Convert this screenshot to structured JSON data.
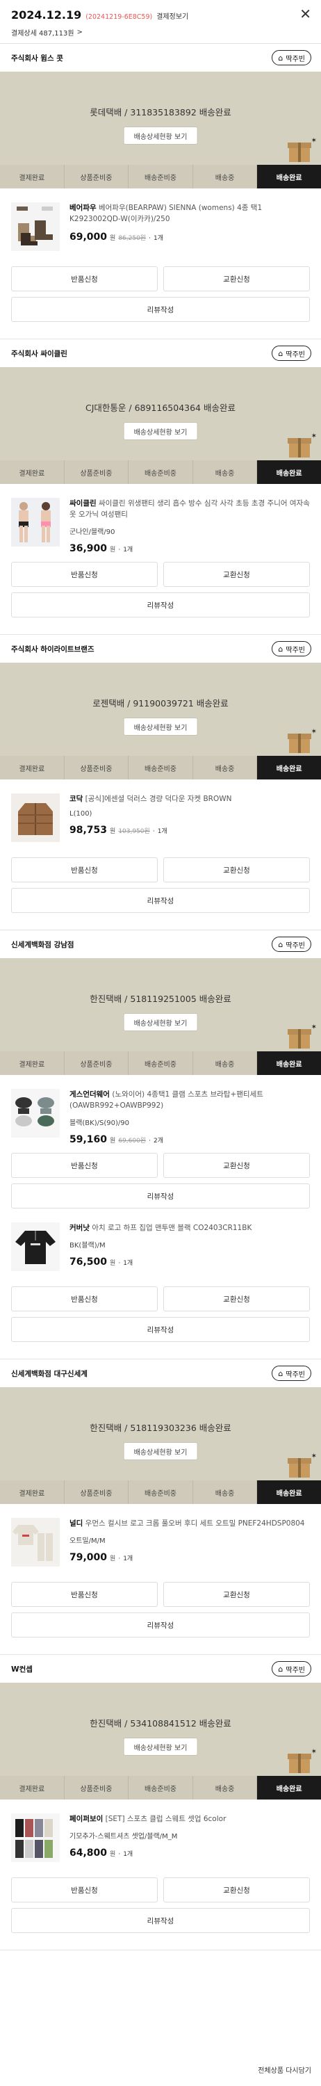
{
  "header": {
    "date": "2024.12.19",
    "order_code": "(20241219-6E8C59)",
    "payment_info": "결제정보기",
    "summary": "결제상세 487,113원",
    "summary_arrow": ">"
  },
  "shop_button_label": "딱주빈",
  "track_button_label": "배송상세현황 보기",
  "steps": [
    "결제완료",
    "상품준비중",
    "배송준비중",
    "배송중",
    "배송완료"
  ],
  "actions": {
    "return": "반품신청",
    "exchange": "교환신청",
    "review": "리뷰작성"
  },
  "sections": [
    {
      "seller": "주식회사 윔스 콧",
      "tracking": "롯데택배 / 311835183892 배송완료",
      "items": [
        {
          "brand": "베어파우",
          "name": "베어파우(BEARPAW) SIENNA (womens) 4종 택1 K2923002QD-W(이카카)/250",
          "option": "",
          "price": "69,000",
          "unit": "원",
          "original": "86,250원",
          "qty": "1개"
        }
      ]
    },
    {
      "seller": "주식회사 싸이클린",
      "tracking": "CJ대한통운 / 689116504364 배송완료",
      "items": [
        {
          "brand": "싸이클린",
          "name": "싸이클린 위생팬티 생리 흡수 방수 심각 사각 초등 초경 주니어 여자속옷 오가닉 여성팬티",
          "option": "군나인/블랙/90",
          "price": "36,900",
          "unit": "원",
          "original": "",
          "qty": "1개"
        }
      ]
    },
    {
      "seller": "주식회사 하이라이트브랜즈",
      "tracking": "로젠택배 / 91190039721 배송완료",
      "items": [
        {
          "brand": "코닥",
          "name": "[공식]에센셜 덕러스 경량 덕다운 자켓 BROWN",
          "option": "L(100)",
          "price": "98,753",
          "unit": "원",
          "original": "103,950원",
          "qty": "1개"
        }
      ]
    },
    {
      "seller": "신세계백화점 강남점",
      "tracking": "한진택배 / 518119251005 배송완료",
      "items": [
        {
          "brand": "게스언더웨어",
          "name": "(노와이어) 4종택1 클램 스포츠 브라탑+팬티세트 (OAWBR992+OAWBP992)",
          "option": "블랙(BK)/S(90)/90",
          "price": "59,160",
          "unit": "원",
          "original": "69,600원",
          "qty": "2개"
        },
        {
          "brand": "커버낫",
          "name": "아치 로고 하프 집업 맨투맨 블랙 CO2403CR11BK",
          "option": "BK(블랙)/M",
          "price": "76,500",
          "unit": "원",
          "original": "",
          "qty": "1개"
        }
      ]
    },
    {
      "seller": "신세계백화점 대구신세계",
      "tracking": "한진택배 / 518119303236 배송완료",
      "items": [
        {
          "brand": "널디",
          "name": "우먼스 컬시브 로고 크롭 풀오버 후디 세트 오트밀 PNEF24HDSP0804",
          "option": "오트밀/M/M",
          "price": "79,000",
          "unit": "원",
          "original": "",
          "qty": "1개"
        }
      ]
    },
    {
      "seller": "W컨셉",
      "tracking": "한진택배 / 534108841512 배송완료",
      "items": [
        {
          "brand": "페이퍼보이",
          "name": "[SET] 스포츠 클럽 스웨트 셋업 6color",
          "option": "기모추가-스웨트셔츠 셋업/블랙/M_M",
          "price": "64,800",
          "unit": "원",
          "original": "",
          "qty": "1개"
        }
      ]
    }
  ],
  "footer": {
    "reorder": "전체상품 다시담기"
  },
  "colors": {
    "track_bg": "#d5d1c0",
    "active_step": "#1a1a1a",
    "order_code": "#e55555"
  }
}
